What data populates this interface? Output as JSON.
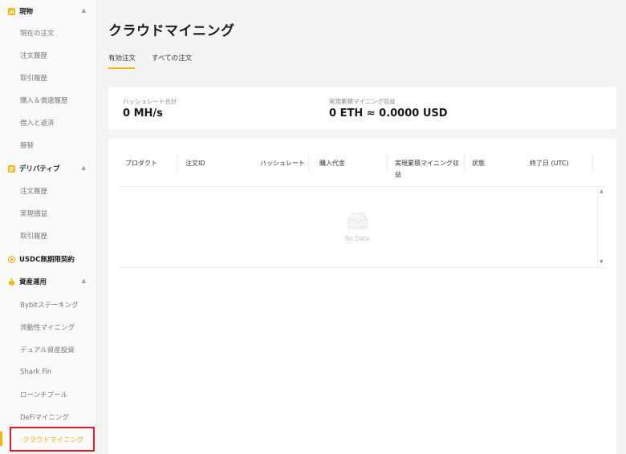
{
  "sidebar": {
    "spot": {
      "title": "現物",
      "items": [
        "現在の注文",
        "注文履歴",
        "取引履歴",
        "購入＆償還履歴",
        "借入と返済",
        "振替"
      ]
    },
    "derivatives": {
      "title": "デリバティブ",
      "items": [
        "注文履歴",
        "実現損益",
        "取引履歴"
      ]
    },
    "usdc": {
      "title": "USDC無期限契約"
    },
    "assets": {
      "title": "資産運用",
      "items": [
        "Bybitステーキング",
        "流動性マイニング",
        "デュアル資産投資",
        "Shark Fin",
        "ローンチプール",
        "DeFiマイニング",
        "クラウドマイニング"
      ]
    },
    "chevron": "▲"
  },
  "main": {
    "title": "クラウドマイニング",
    "tabs": [
      "有効注文",
      "すべての注文"
    ],
    "stats": {
      "hashrate_label": "ハッシュレート合計",
      "hashrate_value": "0 MH/s",
      "earnings_label": "実現累積マイニング収益",
      "earnings_value": "0 ETH ≈ 0.0000 USD"
    },
    "table": {
      "columns": [
        "プロダクト",
        "注文ID",
        "ハッシュレート",
        "購入代金",
        "実現累積マイニング収益",
        "状態",
        "終了日 (UTC)"
      ],
      "empty_text": "No Data",
      "scroll_up": "▲",
      "scroll_down": "▼"
    }
  },
  "colors": {
    "accent": "#f4b414",
    "highlight_border": "#e21b2a",
    "background": "#f4f4f5"
  }
}
